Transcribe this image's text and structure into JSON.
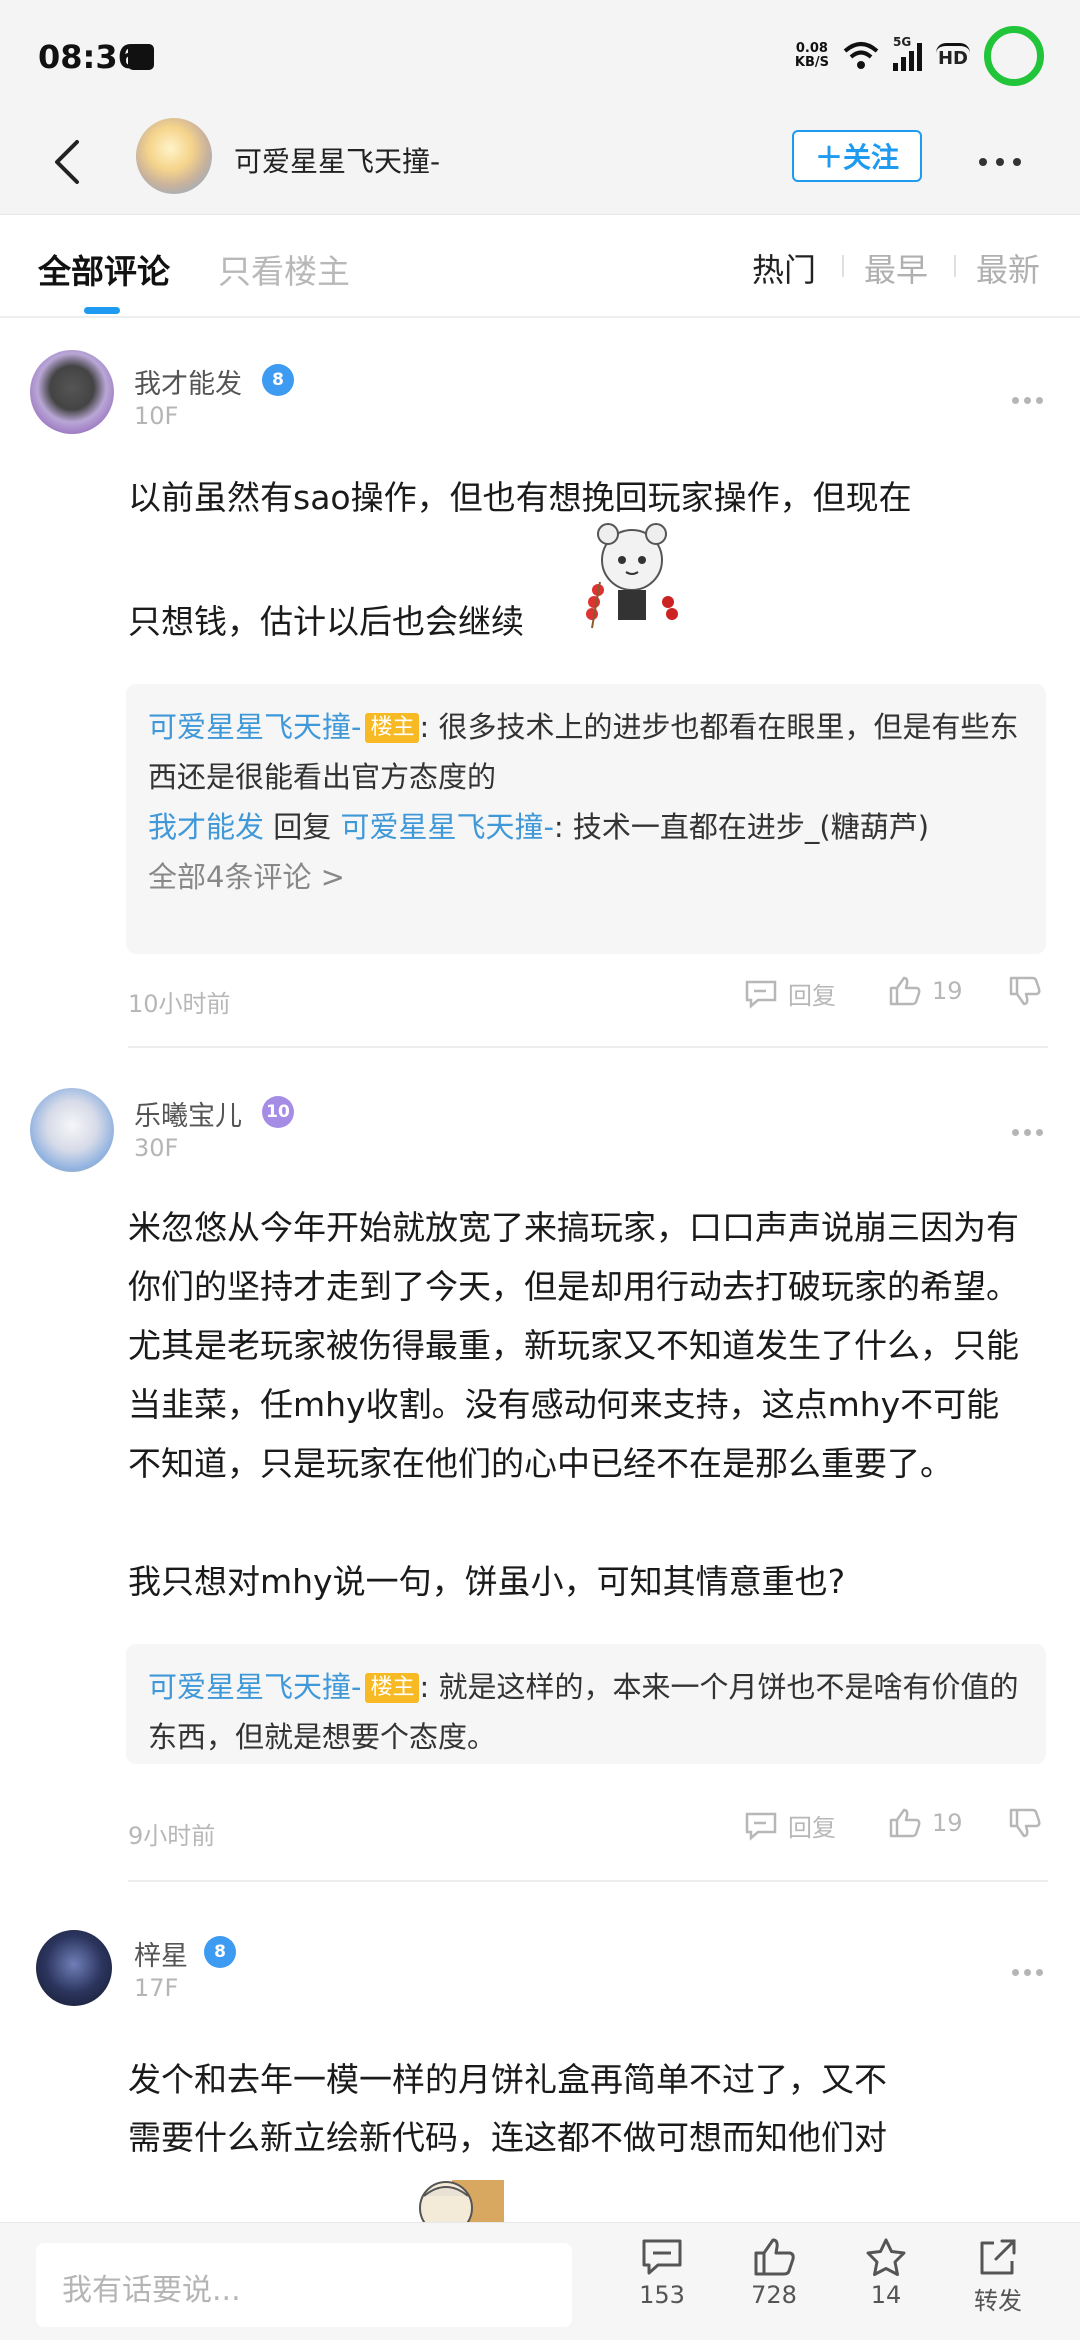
{
  "status": {
    "time": "08:36",
    "net_speed_top": "0.08",
    "net_speed_bottom": "KB/S",
    "net_gen": "5G",
    "hd": "HD"
  },
  "header": {
    "title": "可爱星星飞天撞-",
    "follow_label": "＋关注"
  },
  "tabs": {
    "all": "全部评论",
    "op_only": "只看楼主"
  },
  "sort": {
    "hot": "热门",
    "earliest": "最早",
    "latest": "最新"
  },
  "comments": [
    {
      "username": "我才能发",
      "level": "8",
      "floor": "10F",
      "text_line1": "以前虽然有sao操作，但也有想挽回玩家操作，但现在",
      "text_line2": "只想钱，估计以后也会继续",
      "replies": {
        "r1_user": "可爱星星飞天撞-",
        "r1_tag": "楼主",
        "r1_text": ": 很多技术上的进步也都看在眼里，但是有些东西还是很能看出官方态度的",
        "r2_user": "我才能发",
        "r2_verb": " 回复 ",
        "r2_target": "可爱星星飞天撞-",
        "r2_text": ": 技术一直都在进步_(糖葫芦)",
        "all": "全部4条评论 >"
      },
      "time": "10小时前",
      "reply_label": "回复",
      "likes": "19"
    },
    {
      "username": "乐曦宝儿",
      "level": "10",
      "floor": "30F",
      "text": "米忽悠从今年开始就放宽了来搞玩家，口口声声说崩三因为有你们的坚持才走到了今天，但是却用行动去打破玩家的希望。尤其是老玩家被伤得最重，新玩家又不知道发生了什么，只能当韭菜，任mhy收割。没有感动何来支持，这点mhy不可能不知道，只是玩家在他们的心中已经不在是那么重要了。",
      "text2": "我只想对mhy说一句，饼虽小，可知其情意重也?",
      "replies": {
        "r1_user": "可爱星星飞天撞-",
        "r1_tag": "楼主",
        "r1_text": ": 就是这样的，本来一个月饼也不是啥有价值的东西，但就是想要个态度。"
      },
      "time": "9小时前",
      "reply_label": "回复",
      "likes": "19"
    },
    {
      "username": "梓星",
      "level": "8",
      "floor": "17F",
      "text_line1": "发个和去年一模一样的月饼礼盒再简单不过了，又不",
      "text_line2": "需要什么新立绘新代码，连这都不做可想而知他们对"
    }
  ],
  "bottom": {
    "placeholder": "我有话要说...",
    "comments_count": "153",
    "likes_count": "728",
    "favorites_count": "14",
    "share_label": "转发"
  },
  "colors": {
    "accent": "#1e9bf0",
    "op_tag": "#f7b924",
    "link": "#3f98d8",
    "battery": "#22c43a"
  }
}
